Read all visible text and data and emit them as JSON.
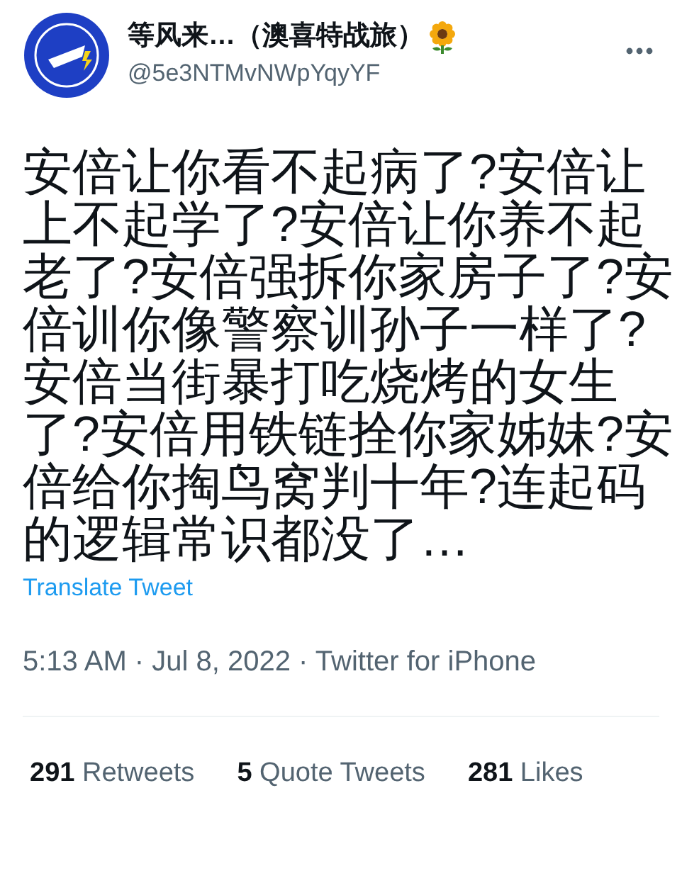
{
  "author": {
    "name": "等风来…（澳喜特战旅）",
    "handle": "@5e3NTMvNWpYqyYF"
  },
  "tweet": {
    "text": "安倍让你看不起病了?安倍让上不起学了?安倍让你养不起老了?安倍强拆你家房子了?安倍训你像警察训孙子一样了?安倍当街暴打吃烧烤的女生了?安倍用铁链拴你家姊妹?安倍给你掏鸟窝判十年?连起码的逻辑常识都没了…",
    "translate": "Translate Tweet"
  },
  "meta": {
    "timestamp": "5:13 AM · Jul 8, 2022 · Twitter for iPhone"
  },
  "stats": [
    {
      "count": "291",
      "label": "Retweets"
    },
    {
      "count": "5",
      "label": "Quote Tweets"
    },
    {
      "count": "281",
      "label": "Likes"
    }
  ]
}
